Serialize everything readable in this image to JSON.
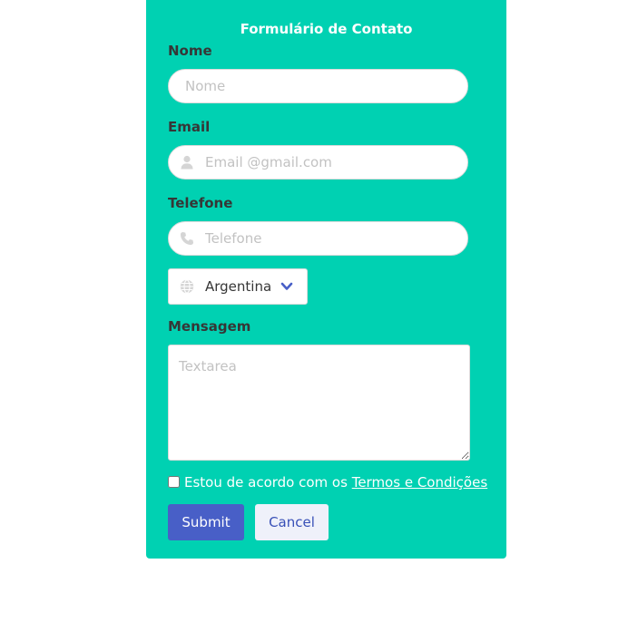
{
  "form": {
    "title": "Formulário de Contato",
    "name": {
      "label": "Nome",
      "placeholder": "Nome"
    },
    "email": {
      "label": "Email",
      "placeholder": "Email @gmail.com",
      "icon": "user-icon"
    },
    "phone": {
      "label": "Telefone",
      "placeholder": "Telefone",
      "icon": "phone-icon"
    },
    "country": {
      "selected": "Argentina",
      "icon": "globe-icon",
      "chevron": "chevron-down-icon"
    },
    "message": {
      "label": "Mensagem",
      "placeholder": "Textarea"
    },
    "agree": {
      "prefix": "Estou de acordo com os ",
      "link": "Termos e Condições",
      "checked": false
    },
    "buttons": {
      "submit": "Submit",
      "cancel": "Cancel"
    }
  },
  "colors": {
    "card_bg": "#00d1b2",
    "label": "#363636",
    "submit_bg": "#485fc7",
    "cancel_bg": "#eff1fa",
    "cancel_text": "#3850b7",
    "icon_gray": "#d5d5d5"
  }
}
